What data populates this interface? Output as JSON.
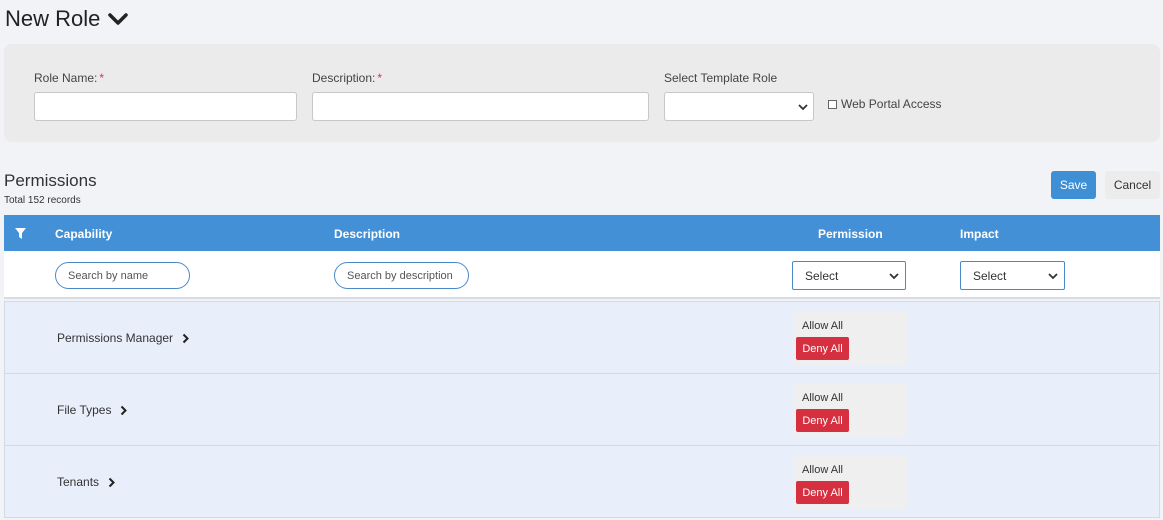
{
  "page": {
    "title": "New Role",
    "title_icon": "chevron-down-icon"
  },
  "form": {
    "role_name_label": "Role Name:",
    "role_name_value": "",
    "description_label": "Description:",
    "description_value": "",
    "required_marker": "*",
    "template_label": "Select Template Role",
    "template_value": "",
    "web_portal_label": "Web Portal Access",
    "web_portal_checked": false
  },
  "permissions": {
    "title": "Permissions",
    "total": "Total 152 records",
    "save_label": "Save",
    "cancel_label": "Cancel",
    "columns": {
      "capability": "Capability",
      "description": "Description",
      "permission": "Permission",
      "impact": "Impact"
    },
    "filters": {
      "name_placeholder": "Search by name",
      "description_placeholder": "Search by description",
      "permission_select": "Select",
      "impact_select": "Select"
    },
    "rows": [
      {
        "name": "Permissions Manager",
        "allow_label": "Allow All",
        "deny_label": "Deny All"
      },
      {
        "name": "File Types",
        "allow_label": "Allow All",
        "deny_label": "Deny All"
      },
      {
        "name": "Tenants",
        "allow_label": "Allow All",
        "deny_label": "Deny All"
      }
    ]
  },
  "colors": {
    "header_blue": "#4390d6",
    "save_blue": "#3f8fd4",
    "deny_red": "#d52f40",
    "row_bg": "#e9eefb",
    "required_red": "#d9333f"
  }
}
